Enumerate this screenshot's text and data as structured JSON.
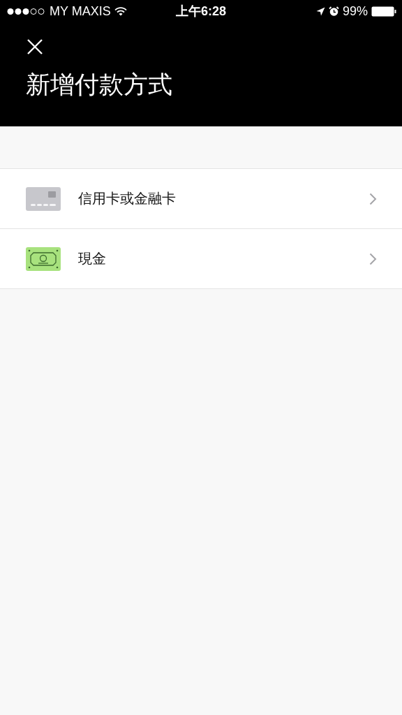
{
  "status_bar": {
    "carrier": "MY MAXIS",
    "time": "上午6:28",
    "battery": "99%"
  },
  "header": {
    "title": "新增付款方式"
  },
  "payment_methods": [
    {
      "kind": "card",
      "label": "信用卡或金融卡"
    },
    {
      "kind": "cash",
      "label": "現金"
    }
  ]
}
